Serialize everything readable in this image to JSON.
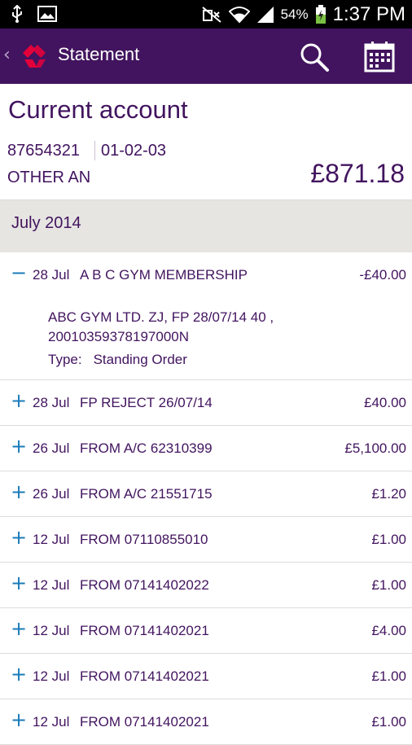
{
  "status_bar": {
    "battery_pct": "54%",
    "time": "1:37 PM",
    "icons": [
      "usb-icon",
      "image-icon",
      "mute-icon",
      "wifi-icon",
      "signal-icon",
      "battery-charging-icon"
    ]
  },
  "app_bar": {
    "title": "Statement",
    "brand_color": "#42145f",
    "logo_color": "#e4003b"
  },
  "account": {
    "title": "Current account",
    "number": "87654321",
    "sort_code": "01-02-03",
    "name": "OTHER AN",
    "balance": "£871.18"
  },
  "month": "July 2014",
  "transactions": [
    {
      "sign": "−",
      "date": "28 Jul",
      "description": "A B C GYM MEMBERSHIP",
      "amount": "-£40.00",
      "detail_line1": "ABC GYM LTD. ZJ, FP 28/07/14 40 ,",
      "detail_line2": "20010359378197000N",
      "type_label": "Type:",
      "type_value": "Standing Order"
    },
    {
      "sign": "+",
      "date": "28 Jul",
      "description": "FP REJECT 26/07/14",
      "amount": "£40.00"
    },
    {
      "sign": "+",
      "date": "26 Jul",
      "description": "FROM A/C 62310399",
      "amount": "£5,100.00"
    },
    {
      "sign": "+",
      "date": "26 Jul",
      "description": "FROM A/C 21551715",
      "amount": "£1.20"
    },
    {
      "sign": "+",
      "date": "12 Jul",
      "description": "FROM 07110855010",
      "amount": "£1.00"
    },
    {
      "sign": "+",
      "date": "12 Jul",
      "description": "FROM 07141402022",
      "amount": "£1.00"
    },
    {
      "sign": "+",
      "date": "12 Jul",
      "description": "FROM 07141402021",
      "amount": "£4.00"
    },
    {
      "sign": "+",
      "date": "12 Jul",
      "description": "FROM 07141402021",
      "amount": "£1.00"
    },
    {
      "sign": "+",
      "date": "12 Jul",
      "description": "FROM 07141402021",
      "amount": "£1.00"
    }
  ]
}
